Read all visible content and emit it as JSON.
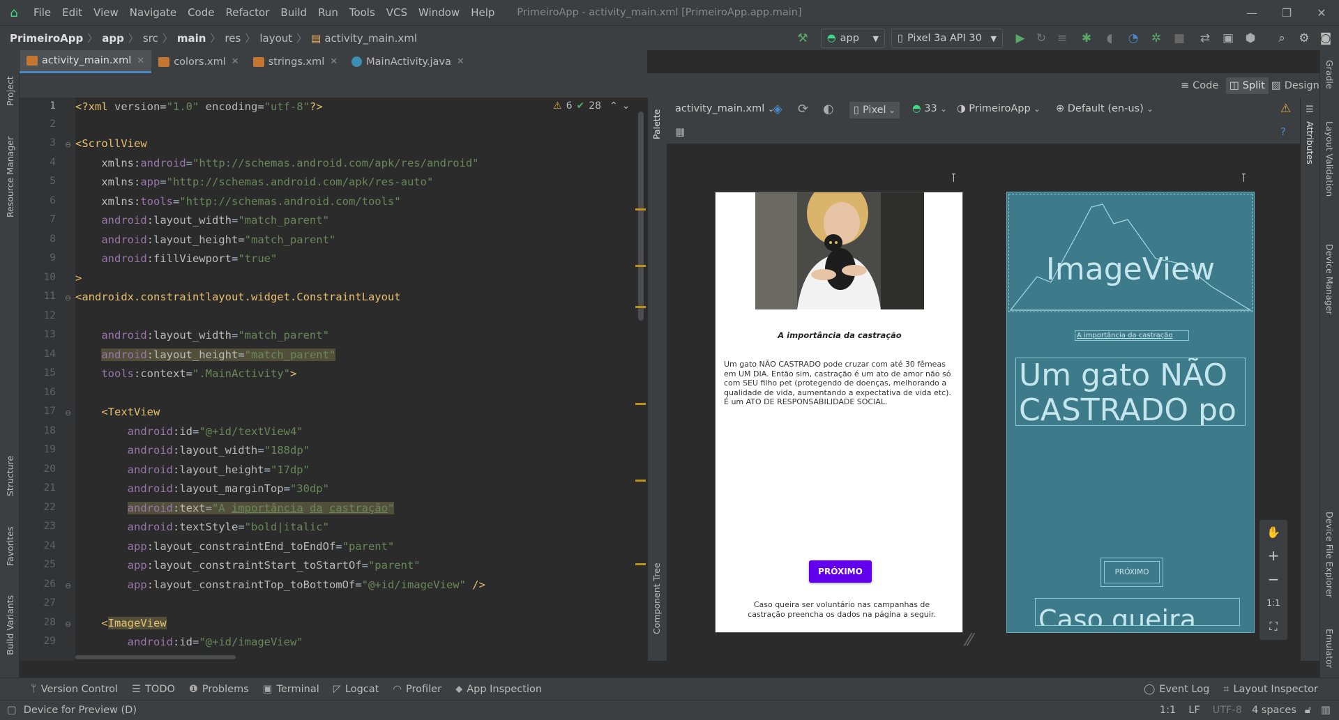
{
  "menu": [
    "File",
    "Edit",
    "View",
    "Navigate",
    "Code",
    "Refactor",
    "Build",
    "Run",
    "Tools",
    "VCS",
    "Window",
    "Help"
  ],
  "window_title": "PrimeiroApp - activity_main.xml [PrimeiroApp.app.main]",
  "breadcrumb": [
    "PrimeiroApp",
    "app",
    "src",
    "main",
    "res",
    "layout",
    "activity_main.xml"
  ],
  "toolbar": {
    "run_config": "app",
    "device": "Pixel 3a API 30"
  },
  "tabs": [
    "activity_main.xml",
    "colors.xml",
    "strings.xml",
    "MainActivity.java"
  ],
  "view_modes": [
    "Code",
    "Split",
    "Design"
  ],
  "left_tools": [
    "Project",
    "Resource Manager",
    "Structure",
    "Favorites",
    "Build Variants"
  ],
  "right_tools": [
    "Gradle",
    "Layout Validation",
    "Device Manager",
    "Device File Explorer",
    "Emulator"
  ],
  "editor": {
    "warnings": "6",
    "checks": "28",
    "line_numbers": [
      "1",
      "2",
      "3",
      "4",
      "5",
      "6",
      "7",
      "8",
      "9",
      "10",
      "11",
      "12",
      "13",
      "14",
      "15",
      "16",
      "17",
      "18",
      "19",
      "20",
      "21",
      "22",
      "23",
      "24",
      "25",
      "26",
      "27",
      "28",
      "29"
    ]
  },
  "design": {
    "file": "activity_main.xml",
    "device": "Pixel",
    "api": "33",
    "theme": "PrimeiroApp",
    "locale": "Default (en-us)",
    "palette_label": "Palette",
    "component_tree_label": "Component Tree",
    "attributes_label": "Attributes",
    "zoom_ratio": "1:1"
  },
  "preview": {
    "title": "A importância da castração",
    "body": "Um gato NÃO CASTRADO pode cruzar com até 30 fêmeas em UM DIA. Então sim, castração é um ato de amor não só com SEU filho pet (protegendo de doenças, melhorando a qualidade de vida, aumentando a expectativa de vida etc). É um ATO DE RESPONSABILIDADE SOCIAL.",
    "button": "PRÓXIMO",
    "footer": "Caso queira ser voluntário nas campanhas de castração preencha os dados na página a seguir."
  },
  "blueprint": {
    "image_label": "ImageView",
    "title": "A importância da castração",
    "body_line1": "Um gato NÃO",
    "body_line2": "CASTRADO po",
    "button": "PRÓXIMO",
    "footer": "Caso queira"
  },
  "bottom_tools": [
    "Version Control",
    "TODO",
    "Problems",
    "Terminal",
    "Logcat",
    "Profiler",
    "App Inspection"
  ],
  "bottom_right_tools": [
    "Event Log",
    "Layout Inspector"
  ],
  "status": {
    "message": "Device for Preview (D)",
    "position": "1:1",
    "line_sep": "LF",
    "encoding": "UTF-8",
    "indent": "4 spaces"
  },
  "colors": {
    "accent": "#4a88c7",
    "button": "#6200ee",
    "blueprint": "#3d7b8a",
    "android_green": "#3ddc84"
  }
}
